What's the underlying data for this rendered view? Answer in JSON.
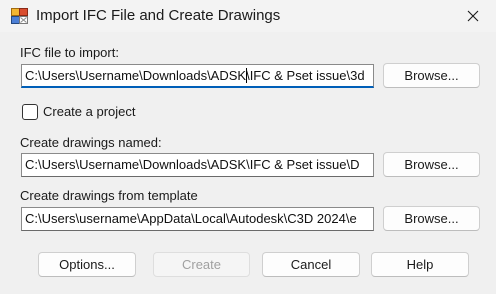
{
  "window": {
    "title": "Import IFC File and Create Drawings",
    "icon": "ifc-import-app-icon",
    "close_icon": "close-icon"
  },
  "ifc_file": {
    "label": "IFC file to import:",
    "value_before_caret": "C:\\Users\\Username\\Downloads\\ADSK",
    "value_after_caret": "\\IFC & Pset issue\\3d",
    "browse_label": "Browse..."
  },
  "create_project": {
    "label": "Create a project",
    "checked": false
  },
  "drawings_named": {
    "label": "Create drawings named:",
    "value": "C:\\Users\\Username\\Downloads\\ADSK\\IFC & Pset issue\\D",
    "browse_label": "Browse..."
  },
  "template": {
    "label": "Create drawings from template",
    "value": "C:\\Users\\username\\AppData\\Local\\Autodesk\\C3D 2024\\e",
    "browse_label": "Browse..."
  },
  "footer": {
    "options_label": "Options...",
    "create_label": "Create",
    "create_enabled": false,
    "cancel_label": "Cancel",
    "help_label": "Help"
  },
  "colors": {
    "background": "#f0f0f0",
    "focus_accent": "#005fb8",
    "disabled_text": "#a0a0a0"
  }
}
